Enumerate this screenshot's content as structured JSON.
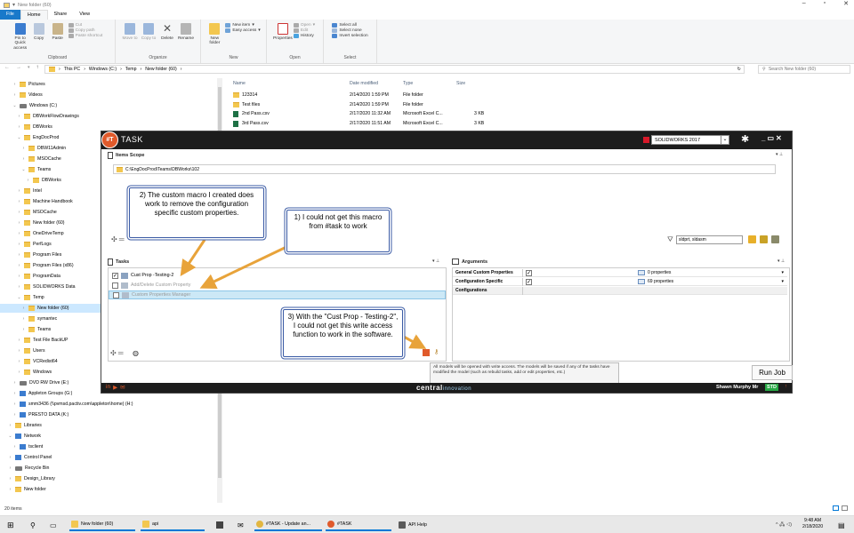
{
  "explorer": {
    "window_title": "New folder (60)",
    "tabs": [
      "File",
      "Home",
      "Share",
      "View"
    ],
    "ribbon": {
      "clipboard": {
        "label": "Clipboard",
        "pin": "Pin to Quick access",
        "copy": "Copy",
        "paste": "Paste",
        "cut": "Cut",
        "copy_path": "Copy path",
        "paste_shortcut": "Paste shortcut"
      },
      "organize": {
        "label": "Organize",
        "move": "Move to",
        "copy": "Copy to",
        "delete": "Delete",
        "rename": "Rename"
      },
      "new": {
        "label": "New",
        "new_folder": "New folder",
        "new_item": "New item",
        "easy_access": "Easy access"
      },
      "open": {
        "label": "Open",
        "properties": "Properties",
        "open": "Open",
        "edit": "Edit",
        "history": "History"
      },
      "select": {
        "label": "Select",
        "select_all": "Select all",
        "select_none": "Select none",
        "invert": "Invert selection"
      }
    },
    "address": {
      "crumbs": [
        "This PC",
        "Windows (C:)",
        "Temp",
        "New folder (60)"
      ],
      "search_placeholder": "Search New folder (60)"
    },
    "nav_tree": [
      {
        "label": "Pictures",
        "indent": 1,
        "type": "folder"
      },
      {
        "label": "Videos",
        "indent": 1,
        "type": "folder"
      },
      {
        "label": "Windows (C:)",
        "indent": 1,
        "type": "drive",
        "open": true
      },
      {
        "label": "DBWorkFlowDrawings",
        "indent": 2,
        "type": "folder"
      },
      {
        "label": "DBWorks",
        "indent": 2,
        "type": "folder"
      },
      {
        "label": "EngDocProd",
        "indent": 2,
        "type": "folder",
        "open": true
      },
      {
        "label": "DBW11Admin",
        "indent": 3,
        "type": "folder"
      },
      {
        "label": "MSOCache",
        "indent": 3,
        "type": "folder"
      },
      {
        "label": "Teams",
        "indent": 3,
        "type": "folder",
        "open": true
      },
      {
        "label": "DBWorks",
        "indent": 4,
        "type": "folder"
      },
      {
        "label": "Intel",
        "indent": 2,
        "type": "folder"
      },
      {
        "label": "Machine Handbook",
        "indent": 2,
        "type": "folder"
      },
      {
        "label": "MSOCache",
        "indent": 2,
        "type": "folder"
      },
      {
        "label": "New folder (60)",
        "indent": 2,
        "type": "folder"
      },
      {
        "label": "OneDriveTemp",
        "indent": 2,
        "type": "folder"
      },
      {
        "label": "PerfLogs",
        "indent": 2,
        "type": "folder"
      },
      {
        "label": "Program Files",
        "indent": 2,
        "type": "folder"
      },
      {
        "label": "Program Files (x86)",
        "indent": 2,
        "type": "folder"
      },
      {
        "label": "ProgramData",
        "indent": 2,
        "type": "folder"
      },
      {
        "label": "SOLIDWORKS Data",
        "indent": 2,
        "type": "folder"
      },
      {
        "label": "Temp",
        "indent": 2,
        "type": "folder",
        "open": true
      },
      {
        "label": "New folder (60)",
        "indent": 3,
        "type": "folder",
        "selected": true
      },
      {
        "label": "symantec",
        "indent": 3,
        "type": "folder"
      },
      {
        "label": "Teams",
        "indent": 3,
        "type": "folder"
      },
      {
        "label": "Test File BackUP",
        "indent": 2,
        "type": "folder"
      },
      {
        "label": "Users",
        "indent": 2,
        "type": "folder"
      },
      {
        "label": "VCRedist64",
        "indent": 2,
        "type": "folder"
      },
      {
        "label": "Windows",
        "indent": 2,
        "type": "folder"
      },
      {
        "label": "DVD RW Drive (E:)",
        "indent": 1,
        "type": "drive"
      },
      {
        "label": "Appleton Groups (G:)",
        "indent": 1,
        "type": "net"
      },
      {
        "label": "smm3436 (\\\\pvmsd.pactiv.com\\appleton\\home) (H:)",
        "indent": 1,
        "type": "net"
      },
      {
        "label": "PRESTO DATA (K:)",
        "indent": 1,
        "type": "net"
      },
      {
        "label": "Libraries",
        "indent": 0,
        "type": "folder"
      },
      {
        "label": "Network",
        "indent": 0,
        "type": "net",
        "open": true
      },
      {
        "label": "tsclient",
        "indent": 1,
        "type": "net"
      },
      {
        "label": "Control Panel",
        "indent": 0,
        "type": "net"
      },
      {
        "label": "Recycle Bin",
        "indent": 0,
        "type": "drive"
      },
      {
        "label": "Design_Library",
        "indent": 0,
        "type": "folder"
      },
      {
        "label": "New folder",
        "indent": 0,
        "type": "folder"
      }
    ],
    "columns": [
      "Name",
      "Date modified",
      "Type",
      "Size"
    ],
    "files": [
      {
        "name": "123314",
        "date": "2/14/2020 1:59 PM",
        "type": "File folder",
        "size": "",
        "kind": "folder"
      },
      {
        "name": "Test files",
        "date": "2/14/2020 1:59 PM",
        "type": "File folder",
        "size": "",
        "kind": "folder"
      },
      {
        "name": "2nd Pass.csv",
        "date": "2/17/2020 11:32 AM",
        "type": "Microsoft Excel C...",
        "size": "3 KB",
        "kind": "csv"
      },
      {
        "name": "3rd Pass.csv",
        "date": "2/17/2020 11:51 AM",
        "type": "Microsoft Excel C...",
        "size": "3 KB",
        "kind": "csv"
      }
    ],
    "status": "20 items"
  },
  "task": {
    "title": "TASK",
    "logo_text": "#T",
    "cad_select": "SOLIDWORKS 2017",
    "items_scope": {
      "header": "Items Scope",
      "path": "C:\\EngDocProd\\Teams\\DBWorks\\102",
      "filter": "sldprt, sldasm"
    },
    "tasks_header": "Tasks",
    "tasks": [
      {
        "label": "Cust Prop -Testing-2",
        "checked": true,
        "dim": false
      },
      {
        "label": "Add/Delete Custom Property",
        "checked": false,
        "dim": true
      },
      {
        "label": "Custom Properties Manager",
        "checked": false,
        "dim": true
      }
    ],
    "arguments_header": "Arguments",
    "arguments": [
      {
        "key": "General Custom Properties",
        "checked": true,
        "value": "0 properties"
      },
      {
        "key": "Configuration Specific",
        "checked": true,
        "value": "69 properties"
      },
      {
        "key": "Configurations",
        "checked": false,
        "value": ""
      }
    ],
    "tooltip": "All models will be opened with write access. The models will be saved if any of the tasks have modified the model (such as rebuild tasks, add or edit properties, etc.)",
    "run_job": "Run Job",
    "footer_brand": "central",
    "footer_brand_small": "innovation",
    "user": "Shawn Murphy Mr",
    "license_badge": "STD"
  },
  "callouts": {
    "c1": "1) I could not get this macro from #task to work",
    "c2": "2) The custom macro I created does work to remove the configuration specific custom properties.",
    "c3": "3) With the \"Cust Prop - Testing-2\", I could not get this write access function to work in the software."
  },
  "taskbar": {
    "items": [
      {
        "label": "New folder (60)"
      },
      {
        "label": "api"
      },
      {
        "label": "#TASK - Update an..."
      },
      {
        "label": "#TASK"
      },
      {
        "label": "API Help"
      }
    ],
    "time": "9:48 AM",
    "date": "2/18/2020"
  },
  "colors": {
    "accent": "#1979ca",
    "arrow": "#e8a33a",
    "callout_border": "#3b5ba5",
    "task_orange": "#e05a2b"
  }
}
